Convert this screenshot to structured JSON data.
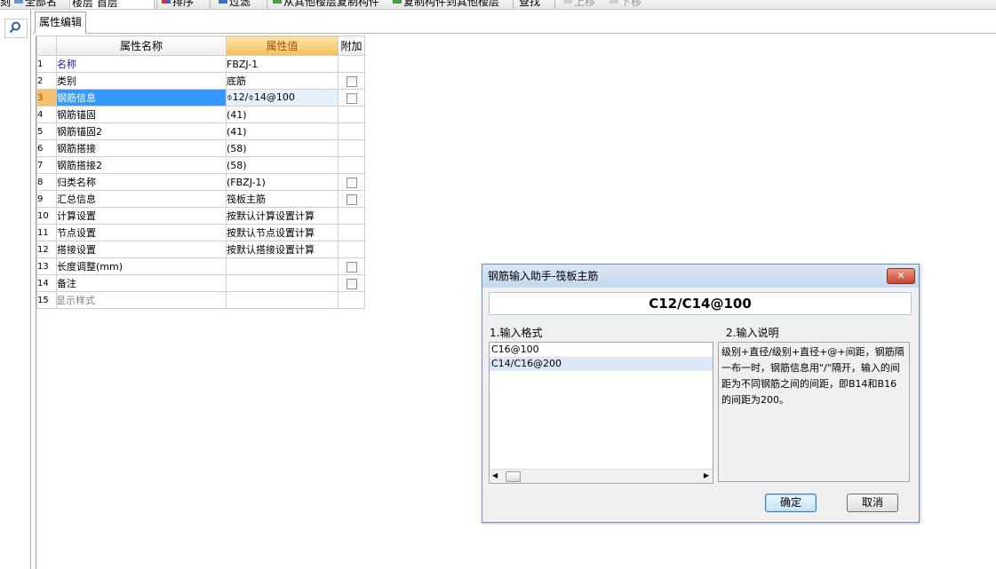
{
  "toolbar": {
    "items": [
      "刻",
      "全部名",
      "楼层 首层",
      "排序",
      "过滤",
      "从其他楼层复制构件",
      "复制构件到其他楼层",
      "查找",
      "上移",
      "下移"
    ]
  },
  "panel": {
    "tab_label": "属性编辑"
  },
  "grid": {
    "headers": {
      "name": "属性名称",
      "value": "属性值",
      "extra": "附加"
    },
    "rows": [
      {
        "num": "1",
        "name": "名称",
        "value": "FBZJ-1",
        "checkbox": false
      },
      {
        "num": "2",
        "name": "类别",
        "value": "底筋",
        "checkbox": true
      },
      {
        "num": "3",
        "name": "钢筋信息",
        "value": "⌽12/⌽14@100",
        "checkbox": true
      },
      {
        "num": "4",
        "name": "钢筋锚固",
        "value": "(41)",
        "checkbox": false
      },
      {
        "num": "5",
        "name": "钢筋锚固2",
        "value": "(41)",
        "checkbox": false
      },
      {
        "num": "6",
        "name": "钢筋搭接",
        "value": "(58)",
        "checkbox": false
      },
      {
        "num": "7",
        "name": "钢筋搭接2",
        "value": "(58)",
        "checkbox": false
      },
      {
        "num": "8",
        "name": "归类名称",
        "value": "(FBZJ-1)",
        "checkbox": true
      },
      {
        "num": "9",
        "name": "汇总信息",
        "value": "筏板主筋",
        "checkbox": true
      },
      {
        "num": "10",
        "name": "计算设置",
        "value": "按默认计算设置计算",
        "checkbox": false
      },
      {
        "num": "11",
        "name": "节点设置",
        "value": "按默认节点设置计算",
        "checkbox": false
      },
      {
        "num": "12",
        "name": "搭接设置",
        "value": "按默认搭接设置计算",
        "checkbox": false
      },
      {
        "num": "13",
        "name": "长度调整(mm)",
        "value": "",
        "checkbox": true
      },
      {
        "num": "14",
        "name": "备注",
        "value": "",
        "checkbox": true
      },
      {
        "num": "15",
        "name": "显示样式",
        "value": "",
        "checkbox": false
      }
    ]
  },
  "dialog": {
    "title": "钢筋输入助手-筏板主筋",
    "close_glyph": "✕",
    "display_value": "C12/C14@100",
    "format_label": "1.输入格式",
    "desc_label": "2.输入说明",
    "format_items": [
      "C16@100",
      "C14/C16@200"
    ],
    "description": "级别+直径/级别+直径+@+间距，钢筋隔一布一时，钢筋信息用\"/\"隔开，输入的间距为不同钢筋之间的间距，即B14和B16的间距为200。",
    "ok_label": "确定",
    "cancel_label": "取消"
  }
}
